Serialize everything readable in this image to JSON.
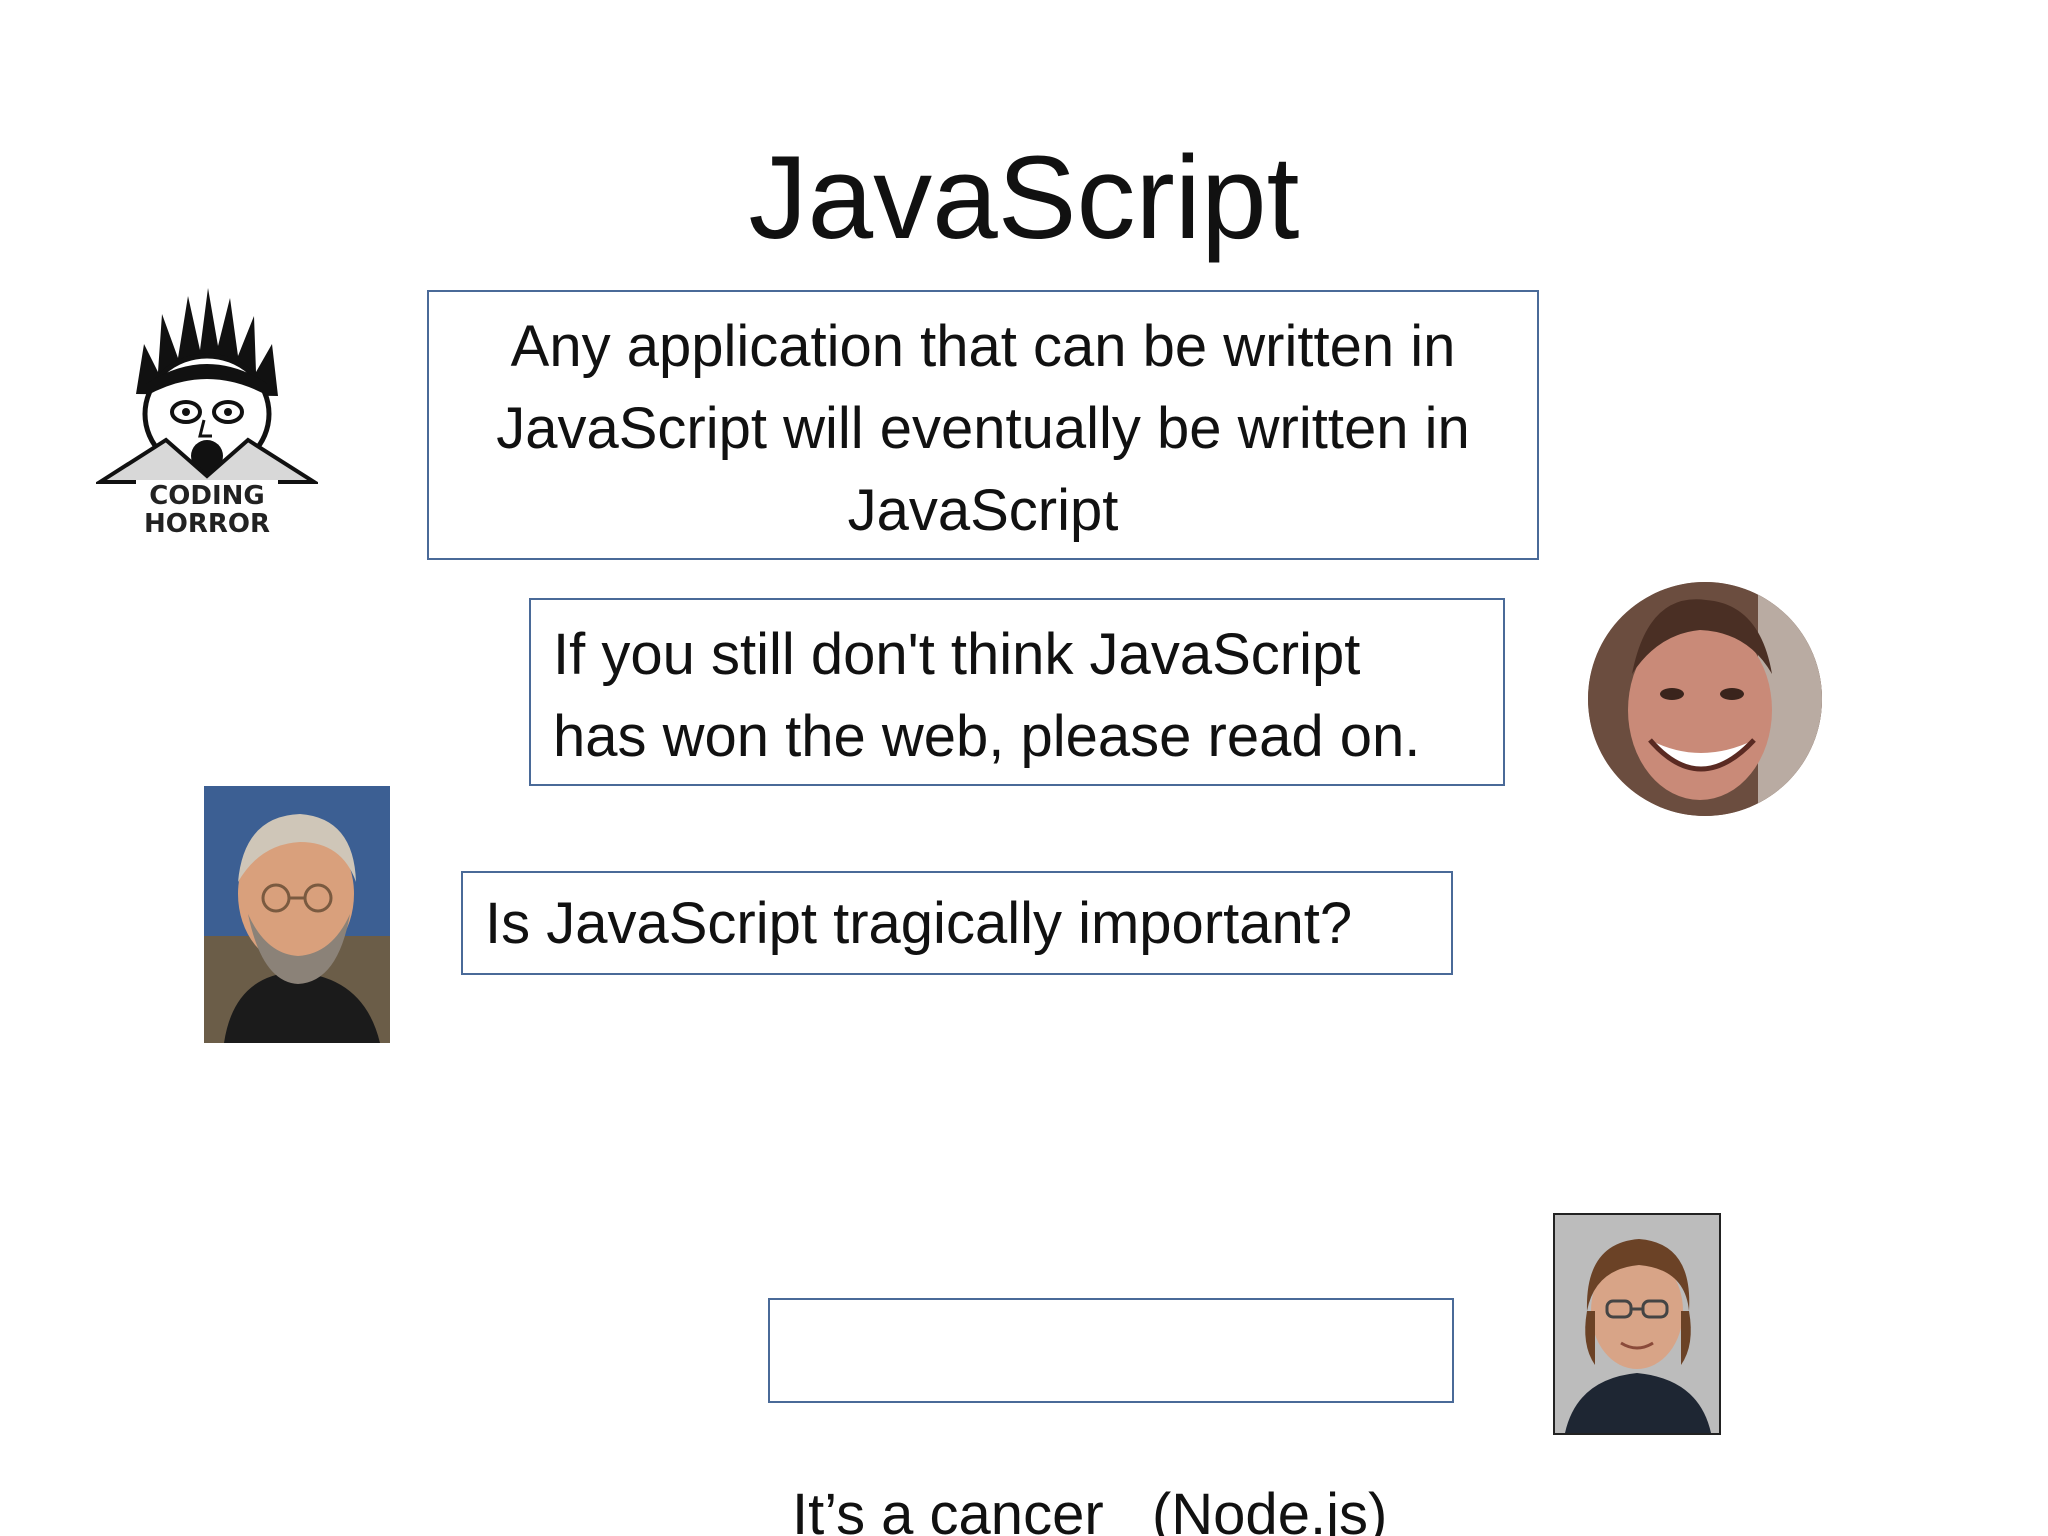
{
  "slide": {
    "title": "JavaScript",
    "quotes": [
      {
        "lines": [
          "Any application that can be written in",
          "JavaScript will eventually be written in",
          "JavaScript"
        ]
      },
      {
        "lines": [
          "If you still don't think JavaScript",
          "has won the web, please read on."
        ]
      },
      {
        "lines": [
          "Is JavaScript tragically important?"
        ]
      },
      {
        "lines": [
          "It’s a cancer   (Node.js)"
        ]
      }
    ],
    "logo": {
      "text_line1": "CODING",
      "text_line2": "HORROR",
      "icon": "coding-horror-logo"
    },
    "colors": {
      "box_border": "#4a6a98",
      "text": "#111111",
      "background": "#ffffff"
    }
  }
}
